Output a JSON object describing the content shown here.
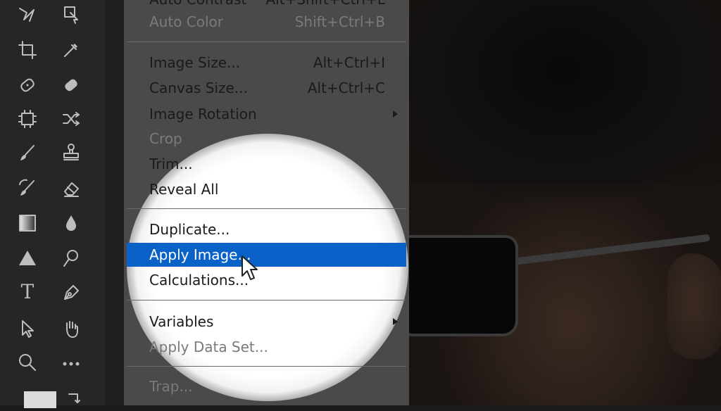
{
  "toolbar": {
    "tools": [
      "magic-lasso-icon",
      "artboard-icon",
      "crop-icon",
      "eyedropper-icon",
      "spot-healing-icon",
      "bandage-icon",
      "content-aware-icon",
      "shuffle-icon",
      "brush-icon",
      "stamp-icon",
      "history-brush-icon",
      "eraser-icon",
      "gradient-icon",
      "blur-drop-icon",
      "triangle-shape-icon",
      "dodge-icon",
      "type-icon",
      "pen-icon",
      "select-arrow-icon",
      "hand-icon",
      "zoom-icon",
      "more-tools-icon"
    ],
    "type_glyph": "T"
  },
  "menu": {
    "top_items": [
      {
        "label": "Auto Contrast",
        "shortcut": "Alt+Shift+Ctrl+L",
        "disabled": false
      },
      {
        "label": "Auto Color",
        "shortcut": "Shift+Ctrl+B",
        "disabled": true
      }
    ],
    "image_size": {
      "label": "Image Size...",
      "shortcut": "Alt+Ctrl+I"
    },
    "canvas_size": {
      "label": "Canvas Size...",
      "shortcut": "Alt+Ctrl+C"
    },
    "image_rotation": {
      "label": "Image Rotation"
    },
    "crop": {
      "label": "Crop"
    },
    "trim": {
      "label": "Trim..."
    },
    "reveal_all": {
      "label": "Reveal All"
    },
    "duplicate": {
      "label": "Duplicate..."
    },
    "apply_image": {
      "label": "Apply Image..."
    },
    "calculations": {
      "label": "Calculations..."
    },
    "variables": {
      "label": "Variables"
    },
    "apply_data_set": {
      "label": "Apply Data Set..."
    },
    "trap": {
      "label": "Trap..."
    }
  },
  "colors": {
    "highlight": "#0a62c9",
    "menu_bg": "#4a4a4a",
    "toolbar_bg": "#262626"
  }
}
